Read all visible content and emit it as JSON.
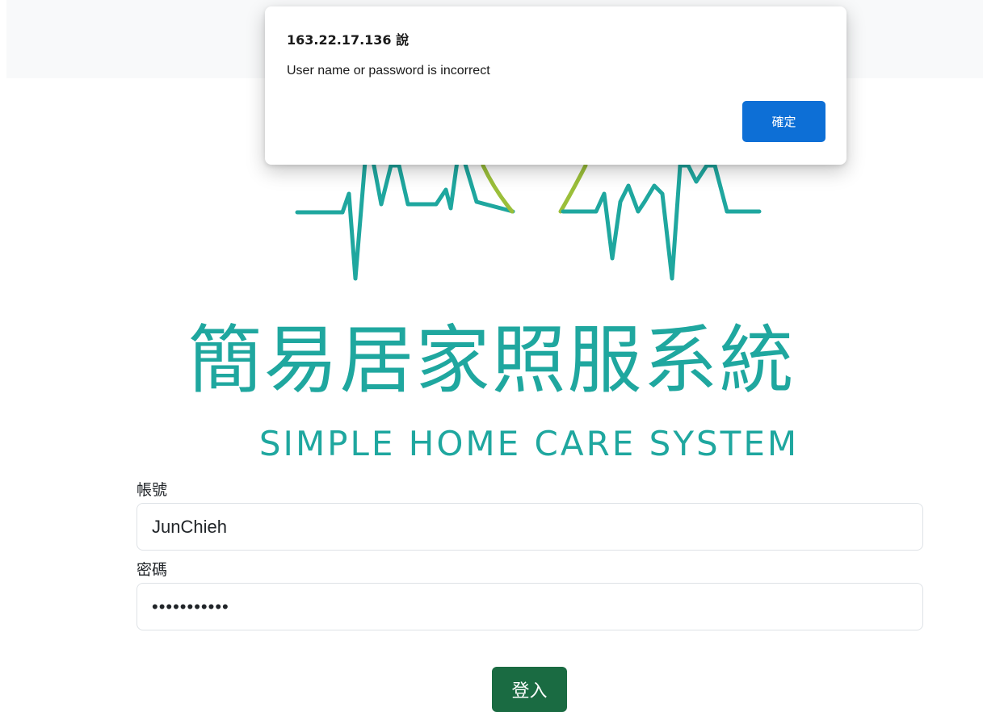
{
  "dialog": {
    "title": "163.22.17.136 說",
    "message": "User name or password is incorrect",
    "ok_label": "確定"
  },
  "logo": {
    "title_zh": "簡易居家照服系統",
    "title_en": "SIMPLE HOME CARE SYSTEM",
    "colors": {
      "teal": "#1fa79f",
      "green": "#9bbf3a"
    }
  },
  "form": {
    "account_label": "帳號",
    "account_value": "JunChieh",
    "password_label": "密碼",
    "password_value": "•••••••••••",
    "login_label": "登入"
  },
  "colors": {
    "login_button": "#1a6b42",
    "dialog_button": "#0d6fd6"
  }
}
